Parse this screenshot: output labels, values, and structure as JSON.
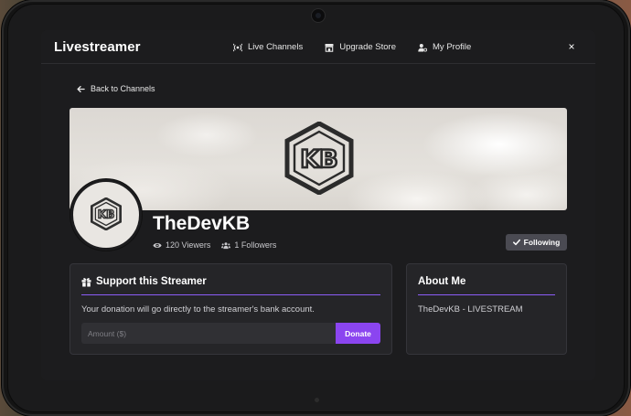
{
  "app": {
    "title": "Livestreamer"
  },
  "nav": {
    "items": [
      {
        "label": "Live Channels",
        "icon": "broadcast-icon"
      },
      {
        "label": "Upgrade Store",
        "icon": "store-icon"
      },
      {
        "label": "My Profile",
        "icon": "user-cog-icon"
      }
    ],
    "close_label": "×"
  },
  "back": {
    "label": "Back to Channels"
  },
  "channel": {
    "name": "TheDevKB",
    "viewers": "120 Viewers",
    "followers": "1 Followers",
    "follow_label": "Following",
    "logo_text": "KB"
  },
  "support": {
    "title": "Support this Streamer",
    "description": "Your donation will go directly to the streamer's bank account.",
    "amount_placeholder": "Amount ($)",
    "donate_label": "Donate"
  },
  "about": {
    "title": "About Me",
    "text": "TheDevKB - LIVESTREAM"
  },
  "colors": {
    "accent": "#8b45f0",
    "underline": "#8b5cf6",
    "background": "#1c1c1e",
    "card": "#252528"
  }
}
